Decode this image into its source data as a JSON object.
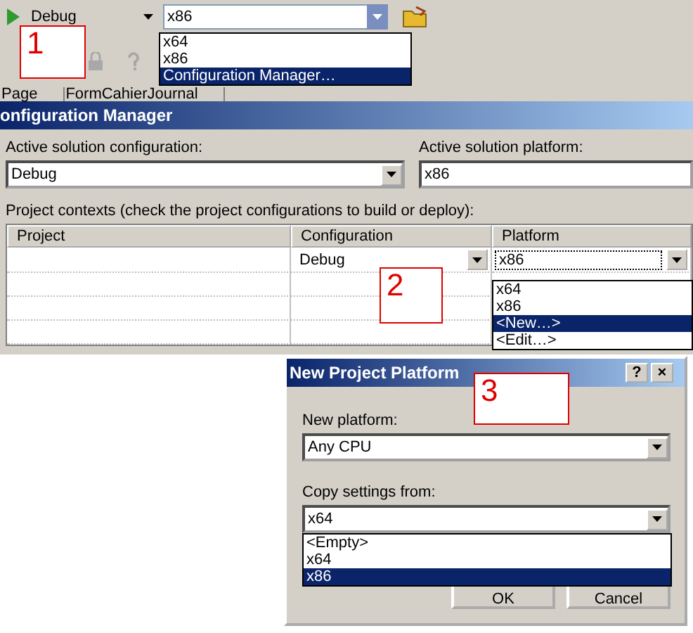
{
  "toolbar": {
    "configuration": "Debug",
    "platform": "x86",
    "platform_menu": [
      {
        "label": "x64",
        "selected": false
      },
      {
        "label": "x86",
        "selected": false
      },
      {
        "label": "Configuration Manager…",
        "selected": true
      }
    ]
  },
  "document_tabs": [
    {
      "label": "Page"
    },
    {
      "label": "FormCahierJournal"
    }
  ],
  "callouts": [
    "1",
    "2",
    "3"
  ],
  "config_manager": {
    "title": "onfiguration Manager",
    "active_configuration_label": "Active solution configuration:",
    "active_configuration": "Debug",
    "active_platform_label": "Active solution platform:",
    "active_platform": "x86",
    "contexts_label": "Project contexts (check the project configurations to build or deploy):",
    "columns": [
      "Project",
      "Configuration",
      "Platform"
    ],
    "rows": [
      {
        "configuration": "Debug",
        "platform": "x86"
      }
    ],
    "platform_menu": [
      {
        "label": "x64",
        "selected": false
      },
      {
        "label": "x86",
        "selected": false
      },
      {
        "label": "<New…>",
        "selected": true
      },
      {
        "label": "<Edit…>",
        "selected": false
      }
    ]
  },
  "new_platform_dialog": {
    "title": "New Project Platform",
    "help": "?",
    "close": "×",
    "new_platform_label": "New platform:",
    "new_platform": "Any CPU",
    "copy_label": "Copy settings from:",
    "copy_from": "x64",
    "copy_menu": [
      {
        "label": "<Empty>",
        "selected": false
      },
      {
        "label": "x64",
        "selected": false
      },
      {
        "label": "x86",
        "selected": true
      }
    ],
    "buttons": [
      "OK",
      "Cancel"
    ]
  }
}
